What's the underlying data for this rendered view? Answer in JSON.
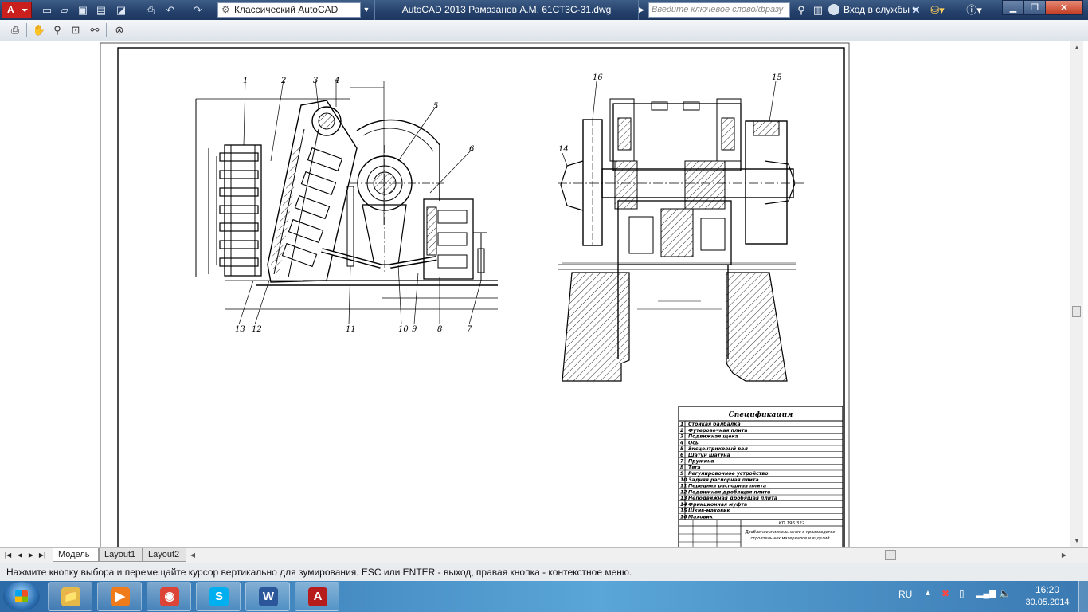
{
  "app": {
    "logo_text": "A",
    "workspace": "Классический AutoCAD",
    "title": "AutoCAD 2013    Рамазанов А.М. 61СТ3С-31.dwg",
    "search_placeholder": "Введите ключевое слово/фразу",
    "signin_label": "Вход в службы"
  },
  "drawing": {
    "callouts_left": [
      "1",
      "2",
      "3",
      "4",
      "5",
      "6",
      "7",
      "8",
      "9",
      "10",
      "11",
      "12",
      "13"
    ],
    "callouts_right": [
      "16",
      "15",
      "14"
    ],
    "spec_title": "Спецификация",
    "spec_items": [
      {
        "n": "1",
        "t": "Стойкая балбалка"
      },
      {
        "n": "2",
        "t": "Футеровочная плита"
      },
      {
        "n": "3",
        "t": "Подвижная щека"
      },
      {
        "n": "4",
        "t": "Ось"
      },
      {
        "n": "5",
        "t": "Эксцентриковый вал"
      },
      {
        "n": "6",
        "t": "Шатун шатуна"
      },
      {
        "n": "7",
        "t": "Пружина"
      },
      {
        "n": "8",
        "t": "Тяга"
      },
      {
        "n": "9",
        "t": "Регулировочное устройство"
      },
      {
        "n": "10",
        "t": "Задняя распорная плита"
      },
      {
        "n": "11",
        "t": "Передняя распорная плита"
      },
      {
        "n": "12",
        "t": "Подвижная дробящая плита"
      },
      {
        "n": "13",
        "t": "Неподвижная дробящая плита"
      },
      {
        "n": "14",
        "t": "Фрикционная муфта"
      },
      {
        "n": "15",
        "t": "Шкив-маховик"
      },
      {
        "n": "16",
        "t": "Маховик"
      }
    ],
    "stamp_code": "КП 196.322",
    "stamp_title_1": "Дробление и измельчение в производстве",
    "stamp_title_2": "строительных материалов и изделий"
  },
  "layout_tabs": [
    "Модель",
    "Layout1",
    "Layout2"
  ],
  "command_line": "Нажмите кнопку выбора и перемещайте курсор вертикально для зумирования. ESC или ENTER - выход, правая кнопка - контекстное меню.",
  "taskbar": {
    "apps": [
      {
        "name": "explorer",
        "label": "📁",
        "color": "#e5b84a"
      },
      {
        "name": "media-player",
        "label": "▶",
        "color": "#f07b1a"
      },
      {
        "name": "chrome",
        "label": "◉",
        "color": "#db4437"
      },
      {
        "name": "skype",
        "label": "S",
        "color": "#00aff0"
      },
      {
        "name": "word",
        "label": "W",
        "color": "#2b579a"
      },
      {
        "name": "autocad",
        "label": "A",
        "color": "#b71c1c"
      }
    ],
    "lang": "RU",
    "time": "16:20",
    "date": "30.05.2014"
  }
}
